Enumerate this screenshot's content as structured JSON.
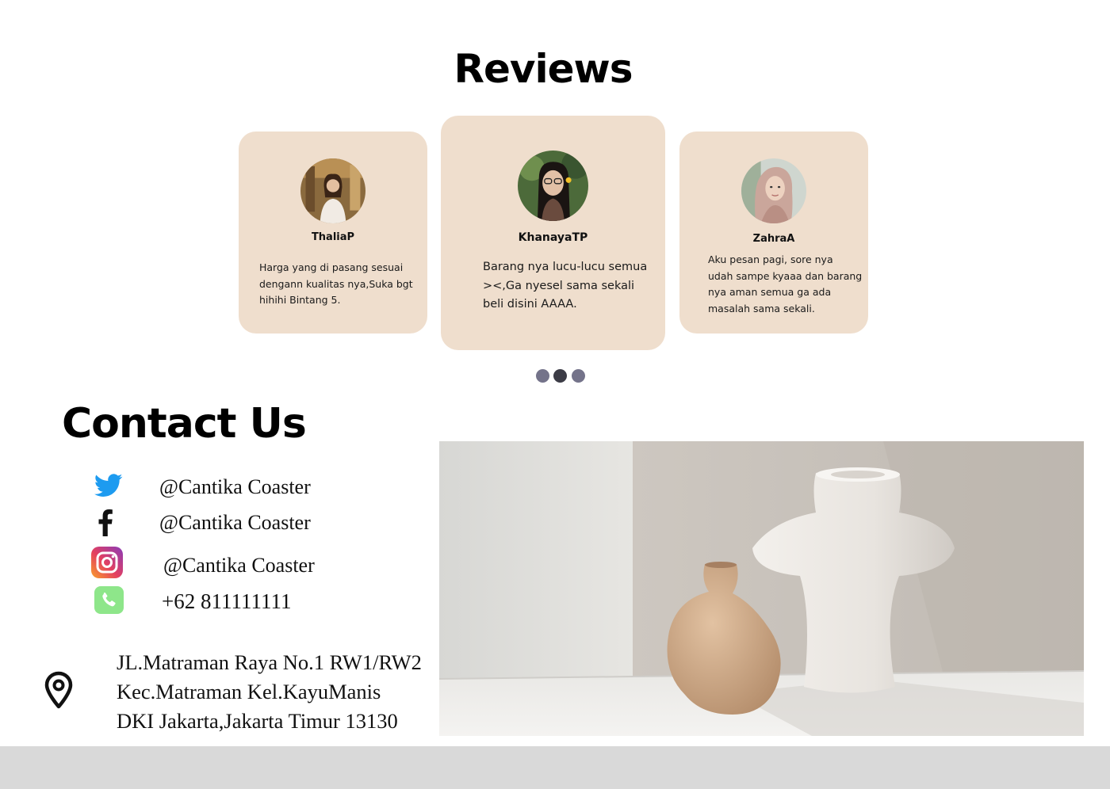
{
  "reviews": {
    "title": "Reviews",
    "cards": [
      {
        "name": "ThaliaP",
        "text": "Harga yang di pasang sesuai\ndengann kualitas nya,Suka bgt\nhihihi Bintang 5."
      },
      {
        "name": "KhanayaTP",
        "text": "Barang nya lucu-lucu semua\n><,Ga nyesel sama sekali\nbeli disini AAAA."
      },
      {
        "name": "ZahraA",
        "text": "Aku pesan pagi, sore nya\nudah sampe kyaaa dan barang\nnya aman semua ga ada\nmasalah sama sekali."
      }
    ],
    "carousel_dots": 3,
    "active_dot": 2
  },
  "contact": {
    "title": "Contact Us",
    "twitter": "@Cantika Coaster",
    "facebook": "@Cantika Coaster",
    "instagram": "@Cantika Coaster",
    "phone": "+62 811111111",
    "address": {
      "line1": "JL.Matraman Raya No.1 RW1/RW2",
      "line2": "Kec.Matraman Kel.KayuManis",
      "line3": "DKI Jakarta,Jakarta Timur 13130"
    }
  },
  "icons": {
    "twitter": "twitter-icon",
    "facebook": "facebook-icon",
    "instagram": "instagram-icon",
    "phone": "phone-icon",
    "location": "map-pin-icon"
  },
  "colors": {
    "card_background": "#efdecd",
    "dot_inactive": "#74738a",
    "dot_active": "#3c3c46",
    "twitter_blue": "#1d9bf0",
    "phone_green": "#8ee68a",
    "footer_bar": "#d9d9d9"
  }
}
